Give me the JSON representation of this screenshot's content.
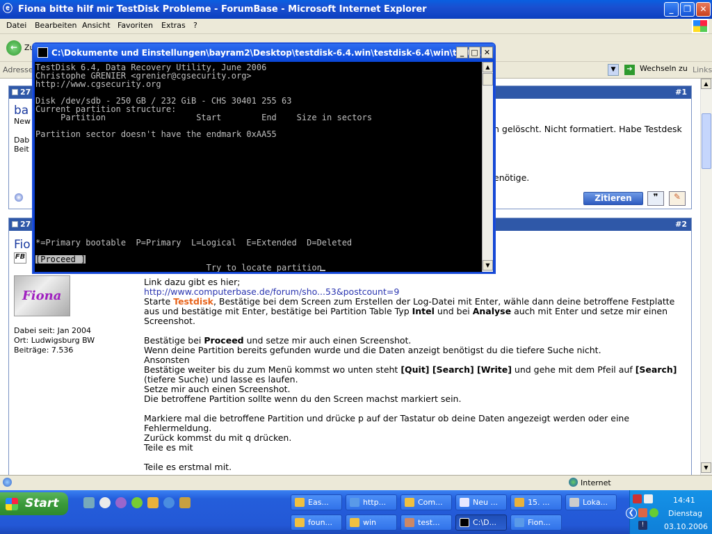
{
  "ie": {
    "title": "Fiona bitte hilf mir TestDisk Probleme - ForumBase - Microsoft Internet Explorer",
    "menu": [
      "Datei",
      "Bearbeiten",
      "Ansicht",
      "Favoriten",
      "Extras",
      "?"
    ],
    "back_label": "Zu",
    "address_label": "Adresse",
    "go_label": "Wechseln zu",
    "links_label": "Links",
    "status_zone": "Internet"
  },
  "post1": {
    "date_fragment": "27",
    "number": "#1",
    "title_fragment": "ba",
    "user_line1": "New",
    "user_line2": "Dab",
    "user_line3": "Beit",
    "text_line1": "n gelöscht. Nicht formatiert. Habe Testdesk",
    "text_line2": "enötige.",
    "quote_button": "Zitieren"
  },
  "post2": {
    "date_fragment": "27",
    "number": "#2",
    "user_name_fragment": "Fio",
    "avatar_text": "Fiona",
    "joined": "Dabei seit: Jan 2004",
    "location": "Ort: Ludwigsburg BW",
    "posts": "Beiträge: 7.536",
    "lines": {
      "l1": "Link dazu gibt es hier;",
      "l2": "http://www.computerbase.de/forum/sho...53&postcount=9",
      "l3a": "Starte ",
      "l3b": "Testdisk",
      "l3c": ", Bestätige bei dem Screen zum Erstellen der Log-Datei mit Enter, wähle dann deine betroffene Festplatte",
      "l4a": "aus und bestätige mit Enter, bestätige bei Partition Table Typ ",
      "l4b": "Intel",
      "l4c": " und bei ",
      "l4d": "Analyse",
      "l4e": " auch mit Enter und setze mir einen",
      "l5": "Screenshot.",
      "l6a": "Bestätige bei ",
      "l6b": "Proceed",
      "l6c": " und setze mir auch einen Screenshot.",
      "l7": "Wenn deine Partition bereits gefunden wurde und die Daten anzeigt benötigst du die tiefere Suche nicht.",
      "l8": "Ansonsten",
      "l9a": "Bestätige weiter bis du zum Menü kommst wo unten steht ",
      "l9b": "[Quit] [Search] [Write]",
      "l9c": " und gehe mit dem Pfeil auf ",
      "l9d": "[Search]",
      "l10": "(tiefere Suche) und lasse es laufen.",
      "l11": "Setze mir auch einen Screenshot.",
      "l12": "Die betroffene Partition sollte wenn du den Screen machst markiert sein.",
      "l13": "Markiere mal die betroffene Partition und drücke p auf der Tastatur ob deine Daten angezeigt werden oder eine",
      "l14": "Fehlermeldung.",
      "l15": "Zurück kommst du mit q drücken.",
      "l16": "Teile es mit",
      "l17": "Teile es erstmal mit."
    }
  },
  "cmd": {
    "title": "C:\\Dokumente und Einstellungen\\bayram2\\Desktop\\testdisk-6.4.win\\testdisk-6.4\\win\\testdi...",
    "lines": {
      "a1": "TestDisk 6.4, Data Recovery Utility, June 2006",
      "a2": "Christophe GRENIER <grenier@cgsecurity.org>",
      "a3": "http://www.cgsecurity.org",
      "a4": "Disk /dev/sdb - 250 GB / 232 GiB - CHS 30401 255 63",
      "a5": "Current partition structure:",
      "a6": "     Partition                  Start        End    Size in sectors",
      "a7": "Partition sector doesn't have the endmark 0xAA55",
      "a8": "*=Primary bootable  P=Primary  L=Logical  E=Extended  D=Deleted",
      "a9": "[Proceed ]",
      "a10": "                                  Try to locate partition"
    }
  },
  "taskbar": {
    "start_label": "Start",
    "items_row1": [
      "Eas...",
      "http...",
      "Com...",
      "Neu ...",
      "15. ...",
      "Loka..."
    ],
    "items_row2": [
      "foun...",
      "win",
      "test...",
      "C:\\D...",
      "Fion..."
    ],
    "clock_time": "14:41",
    "clock_day": "Dienstag",
    "clock_date": "03.10.2006"
  }
}
